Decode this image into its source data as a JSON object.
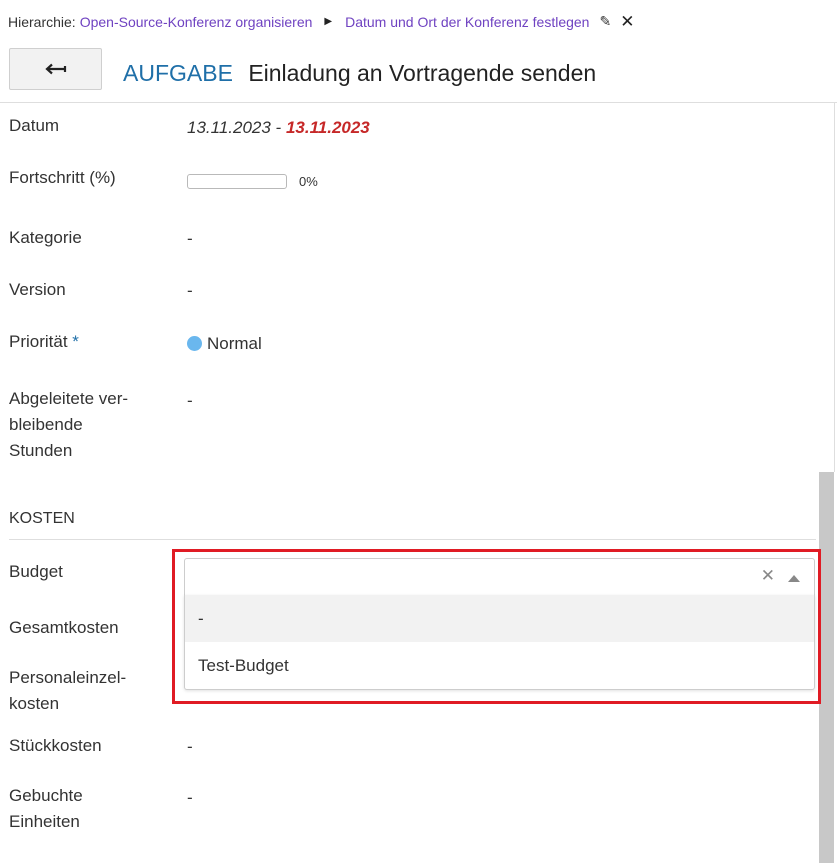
{
  "breadcrumb": {
    "label": "Hierarchie:",
    "items": [
      "Open-Source-Konferenz organisieren",
      "Datum und Ort der Konferenz festlegen"
    ]
  },
  "header": {
    "type": "AUFGABE",
    "subject": "Einladung an Vortragende senden"
  },
  "fields": {
    "date": {
      "label": "Datum",
      "start": "13.11.2023",
      "sep": " - ",
      "end": "13.11.2023"
    },
    "progress": {
      "label": "Fortschritt (%)",
      "value": 0,
      "text": "0%"
    },
    "category": {
      "label": "Kategorie",
      "value": "-"
    },
    "version": {
      "label": "Version",
      "value": "-"
    },
    "priority": {
      "label": "Priorität",
      "required_mark": " *",
      "value": "Normal",
      "color": "#6ab7ee"
    },
    "remaining": {
      "label_lines": [
        "Abgeleitete ver-",
        "bleibende",
        "Stunden"
      ],
      "value": "-"
    }
  },
  "costs": {
    "section_title": "KOSTEN",
    "budget": {
      "label": "Budget",
      "value": "",
      "options": [
        "-",
        "Test-Budget"
      ],
      "highlighted_option": "-"
    },
    "total": {
      "label": "Gesamtkosten"
    },
    "labor": {
      "label_lines": [
        "Personaleinzel-",
        "kosten"
      ]
    },
    "unit": {
      "label": "Stückkosten",
      "value": "-"
    },
    "units_booked": {
      "label_lines": [
        "Gebuchte",
        "Einheiten"
      ],
      "value": "-"
    }
  },
  "colors": {
    "accent": "#1f6fa8",
    "link": "#6f42c1",
    "overdue": "#c62828",
    "highlight": "#e01b24"
  }
}
